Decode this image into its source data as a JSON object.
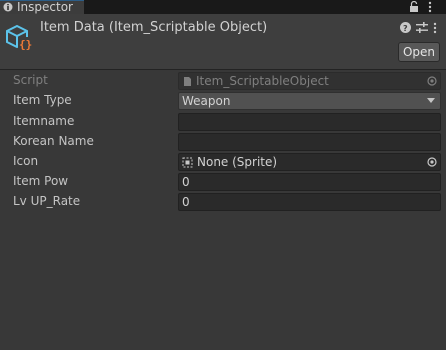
{
  "tab": {
    "label": "Inspector"
  },
  "header": {
    "title": "Item Data (Item_Scriptable Object)",
    "open_label": "Open"
  },
  "fields": {
    "script": {
      "label": "Script",
      "value": "Item_ScriptableObject"
    },
    "item_type": {
      "label": "Item Type",
      "value": "Weapon"
    },
    "itemname": {
      "label": "Itemname",
      "value": ""
    },
    "korean_name": {
      "label": "Korean Name",
      "value": ""
    },
    "icon": {
      "label": "Icon",
      "value": "None (Sprite)"
    },
    "item_pow": {
      "label": "Item Pow",
      "value": "0"
    },
    "lv_up_rate": {
      "label": "Lv UP_Rate",
      "value": "0"
    }
  },
  "icons": {
    "tab": "inspector-info-icon",
    "lock": "lock-icon",
    "menu": "kebab-menu-icon",
    "object": "scriptable-object-icon",
    "help": "help-icon",
    "preset": "preset-sliders-icon",
    "picker": "object-picker-icon",
    "script": "script-file-icon",
    "sprite": "sprite-icon"
  },
  "colors": {
    "background": "#383838",
    "header": "#3e3e3e",
    "field": "#2a2a2a",
    "dropdown": "#515151",
    "accent": "#2c5d87"
  }
}
